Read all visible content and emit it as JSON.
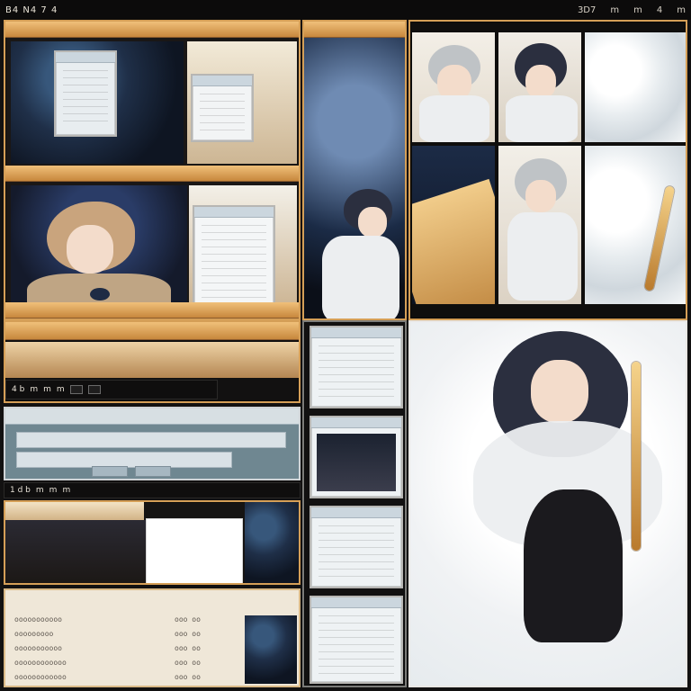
{
  "top_bar": {
    "title": "B4 N4 7 4",
    "tabs": [
      "3D7",
      "m",
      "m",
      "4",
      "m"
    ]
  },
  "toolbars": {
    "left_mid": {
      "label": "4 b",
      "items": [
        "m",
        "m",
        "m"
      ]
    },
    "left_lower": {
      "label": "1 d b",
      "items": [
        "m",
        "m",
        "m"
      ]
    }
  },
  "text_rows": {
    "left_bottom": [
      "ooooooooooo",
      "ooooooooo",
      "ooooooooooo",
      "oooooooooooo",
      "oooooooooooo"
    ],
    "right_bottom": [
      "ooo oo",
      "ooo oo",
      "ooo oo",
      "ooo oo",
      "ooo oo"
    ]
  },
  "colors": {
    "wood": "#d59f57",
    "dark": "#121111",
    "panel_blue": "#6f8791"
  },
  "icons": {
    "menu": "menu-icon",
    "window": "window-icon",
    "scroll": "scroll-icon"
  }
}
